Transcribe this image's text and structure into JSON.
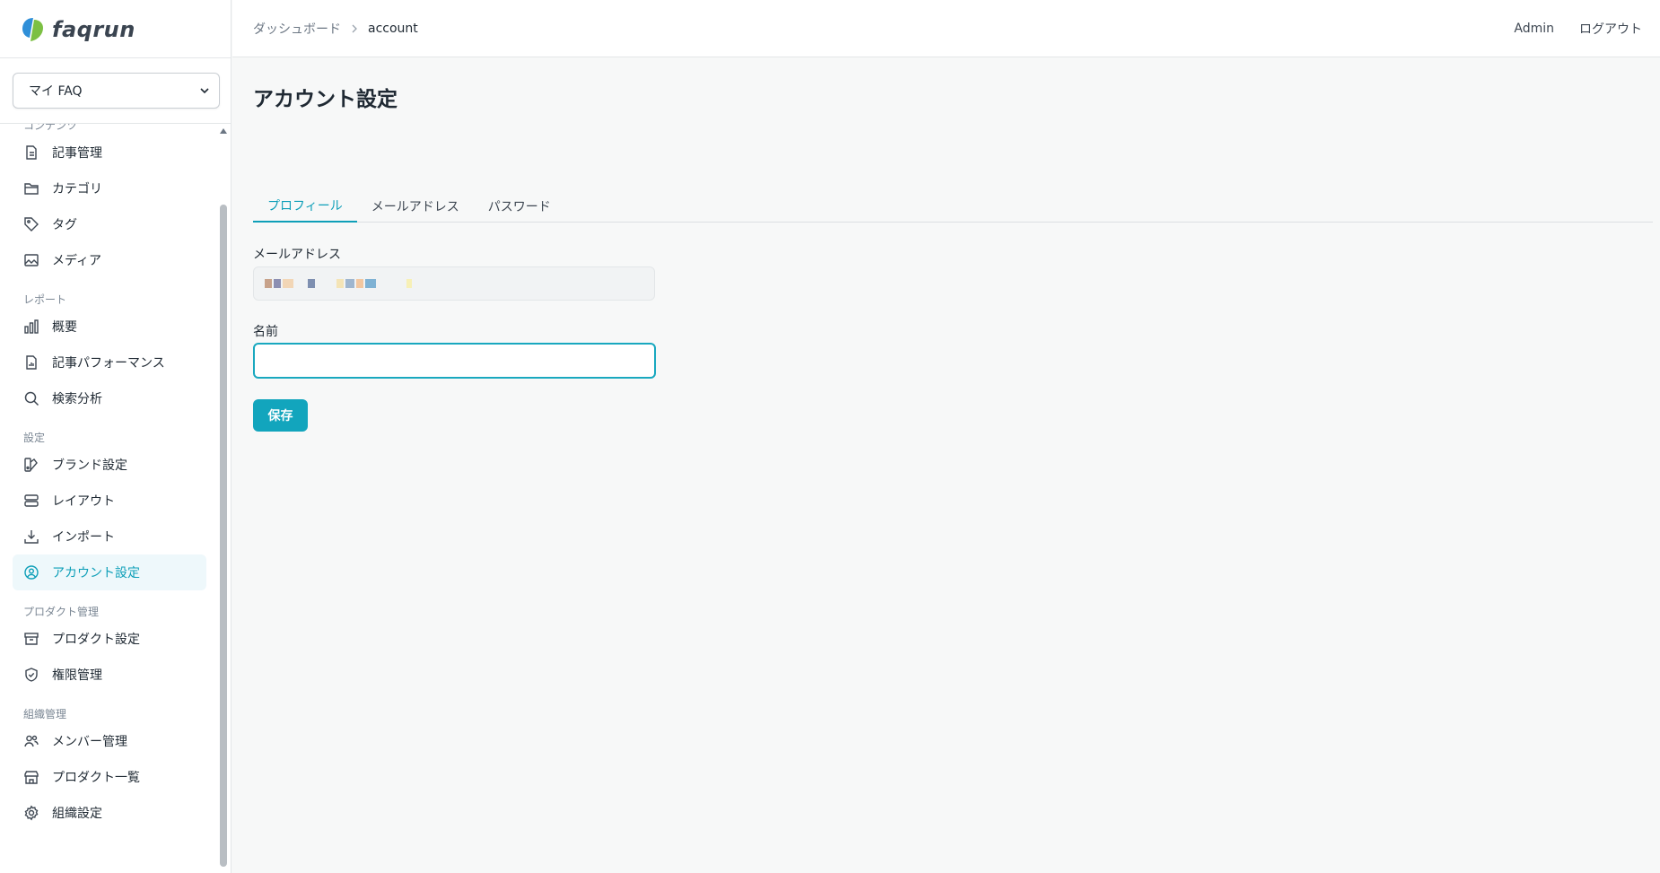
{
  "app": {
    "logo_text": "faqrun"
  },
  "sidebar": {
    "project_select": {
      "value": "マイ FAQ"
    },
    "sections": [
      {
        "title": "コンテンツ",
        "items": [
          {
            "label": "記事管理",
            "icon": "document-icon"
          },
          {
            "label": "カテゴリ",
            "icon": "folder-icon"
          },
          {
            "label": "タグ",
            "icon": "tag-icon"
          },
          {
            "label": "メディア",
            "icon": "image-icon"
          }
        ]
      },
      {
        "title": "レポート",
        "items": [
          {
            "label": "概要",
            "icon": "bar-chart-icon"
          },
          {
            "label": "記事パフォーマンス",
            "icon": "document-chart-icon"
          },
          {
            "label": "検索分析",
            "icon": "search-icon"
          }
        ]
      },
      {
        "title": "設定",
        "items": [
          {
            "label": "ブランド設定",
            "icon": "palette-icon"
          },
          {
            "label": "レイアウト",
            "icon": "layout-icon"
          },
          {
            "label": "インポート",
            "icon": "download-icon"
          },
          {
            "label": "アカウント設定",
            "icon": "user-circle-icon",
            "active": true
          }
        ]
      },
      {
        "title": "プロダクト管理",
        "items": [
          {
            "label": "プロダクト設定",
            "icon": "archive-icon"
          },
          {
            "label": "権限管理",
            "icon": "shield-check-icon"
          }
        ]
      },
      {
        "title": "組織管理",
        "items": [
          {
            "label": "メンバー管理",
            "icon": "users-icon"
          },
          {
            "label": "プロダクト一覧",
            "icon": "store-icon"
          },
          {
            "label": "組織設定",
            "icon": "gear-icon"
          }
        ]
      }
    ]
  },
  "header": {
    "breadcrumb": {
      "parent": "ダッシュボード",
      "current": "account"
    },
    "user": "Admin",
    "logout": "ログアウト"
  },
  "main": {
    "title": "アカウント設定",
    "tabs": [
      {
        "label": "プロフィール",
        "active": true
      },
      {
        "label": "メールアドレス"
      },
      {
        "label": "パスワード"
      }
    ],
    "email_label": "メールアドレス",
    "name_label": "名前",
    "name_value": "",
    "save_label": "保存"
  },
  "colors": {
    "accent": "#12a5bd",
    "active_bg": "#eef8fb"
  }
}
